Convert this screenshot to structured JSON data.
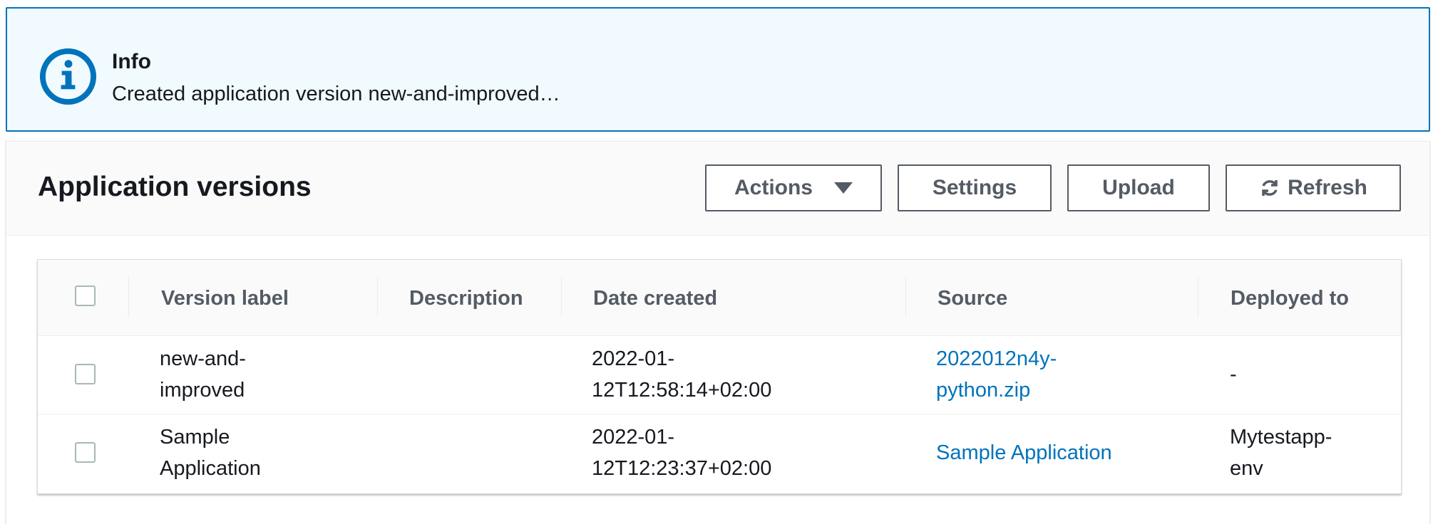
{
  "flash": {
    "icon": "info-icon",
    "title": "Info",
    "message": "Created application version new-and-improved…",
    "accent_color": "#0073bb",
    "background_color": "#f1faff"
  },
  "container": {
    "title": "Application versions",
    "buttons": {
      "actions": "Actions",
      "settings": "Settings",
      "upload": "Upload",
      "refresh": "Refresh"
    }
  },
  "table": {
    "columns": [
      "Version label",
      "Description",
      "Date created",
      "Source",
      "Deployed to"
    ],
    "rows": [
      {
        "version_label_line1": "new-and-",
        "version_label_line2": "improved",
        "description": "",
        "date_line1": "2022-01-",
        "date_line2": "12T12:58:14+02:00",
        "source_line1": "2022012n4y-",
        "source_line2": "python.zip",
        "deployed_line1": "-",
        "deployed_line2": ""
      },
      {
        "version_label_line1": "Sample",
        "version_label_line2": "Application",
        "description": "",
        "date_line1": "2022-01-",
        "date_line2": "12T12:23:37+02:00",
        "source_line1": "Sample Application",
        "source_line2": "",
        "deployed_line1": "Mytestapp-",
        "deployed_line2": "env"
      }
    ]
  },
  "colors": {
    "link": "#0073bb",
    "button_border": "#545b64",
    "header_text": "#545b64"
  }
}
